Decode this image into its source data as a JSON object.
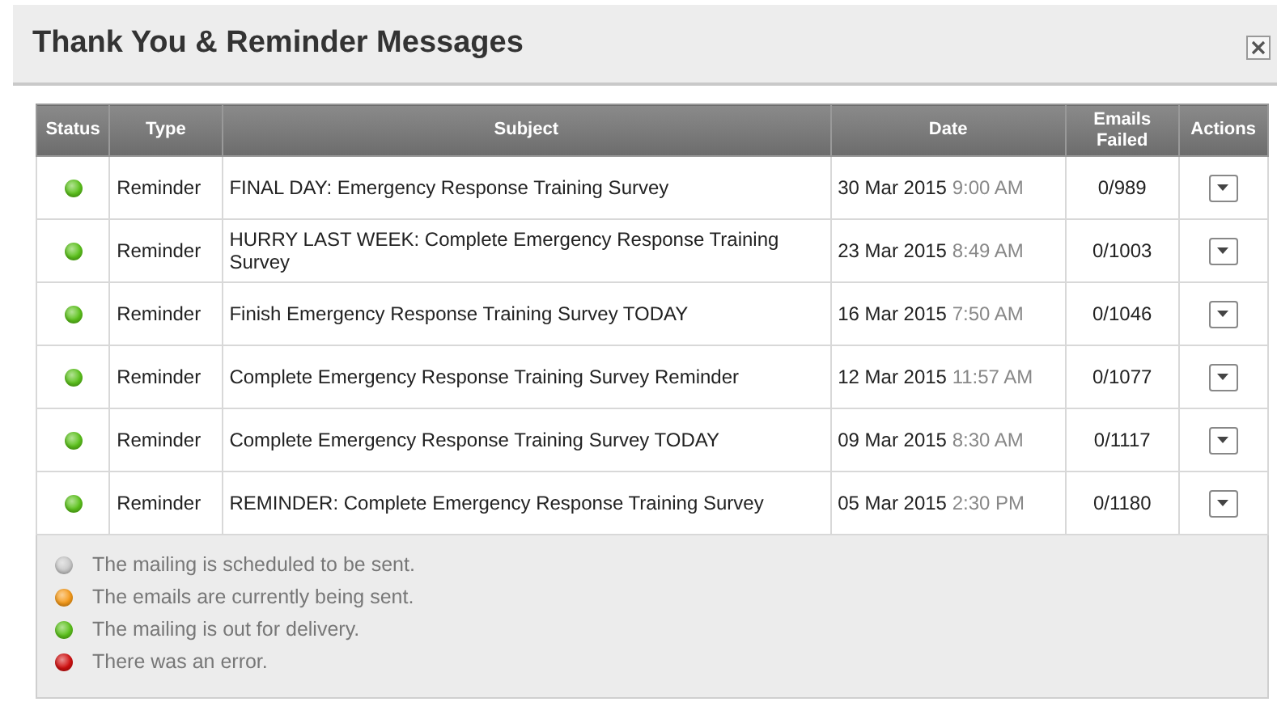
{
  "dialog": {
    "title": "Thank You & Reminder Messages"
  },
  "table": {
    "columns": [
      "Status",
      "Type",
      "Subject",
      "Date",
      "Emails Failed",
      "Actions"
    ],
    "rows": [
      {
        "color": "#5cc21c",
        "type": "Reminder",
        "subject": "FINAL DAY: Emergency Response Training Survey",
        "date": "30 Mar 2015",
        "time": "9:00 AM",
        "emails_failed": "0/989"
      },
      {
        "color": "#5cc21c",
        "type": "Reminder",
        "subject": "HURRY LAST WEEK: Complete Emergency Response Training Survey",
        "date": "23 Mar 2015",
        "time": "8:49 AM",
        "emails_failed": "0/1003"
      },
      {
        "color": "#5cc21c",
        "type": "Reminder",
        "subject": "Finish Emergency Response Training Survey TODAY",
        "date": "16 Mar 2015",
        "time": "7:50 AM",
        "emails_failed": "0/1046"
      },
      {
        "color": "#5cc21c",
        "type": "Reminder",
        "subject": "Complete Emergency Response Training Survey Reminder",
        "date": "12 Mar 2015",
        "time": "11:57 AM",
        "emails_failed": "0/1077"
      },
      {
        "color": "#5cc21c",
        "type": "Reminder",
        "subject": "Complete Emergency Response Training Survey TODAY",
        "date": "09 Mar 2015",
        "time": "8:30 AM",
        "emails_failed": "0/1117"
      },
      {
        "color": "#5cc21c",
        "type": "Reminder",
        "subject": "REMINDER: Complete Emergency Response Training Survey",
        "date": "05 Mar 2015",
        "time": "2:30 PM",
        "emails_failed": "0/1180"
      }
    ]
  },
  "legend": [
    {
      "color": "#c8c8c8",
      "text": "The mailing is scheduled to be sent."
    },
    {
      "color": "#f59a1a",
      "text": "The emails are currently being sent."
    },
    {
      "color": "#5cc21c",
      "text": "The mailing is out for delivery."
    },
    {
      "color": "#d01010",
      "text": "There was an error."
    }
  ]
}
